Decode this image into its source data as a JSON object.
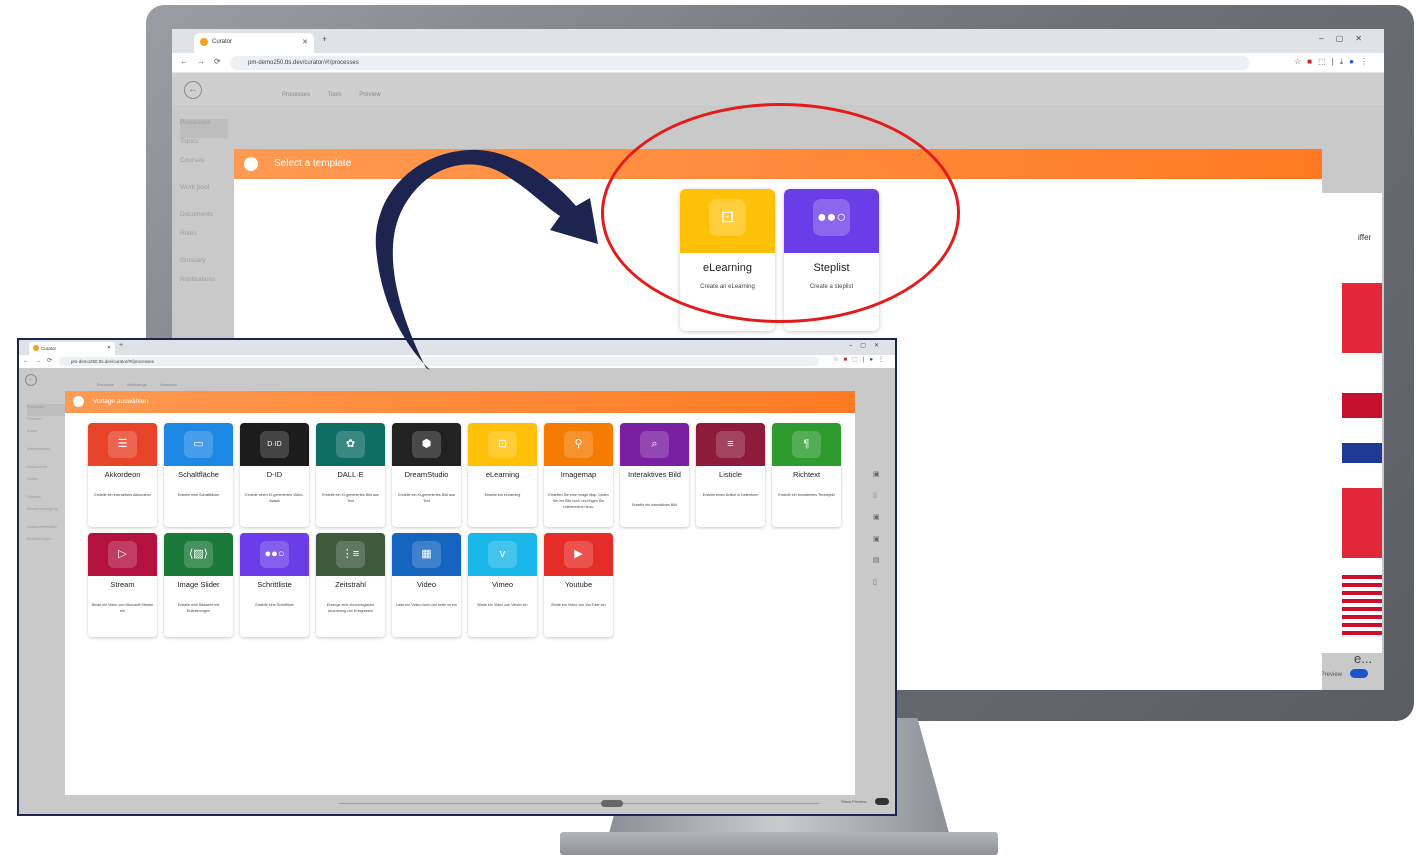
{
  "big_browser": {
    "tab_title": "Curator",
    "url": "pm-demo250.tts.dev/curator/#!/processes",
    "header_tabs": [
      "Processes",
      "Tools",
      "Preview"
    ],
    "nav_items": [
      "Processes",
      "Topics",
      "Courses",
      "Work pool",
      "Documents",
      "Roles",
      "Glossary",
      "Notifications"
    ],
    "right_text_1": "iffer",
    "right_text_2": "e...",
    "show_preview": "Show Preview"
  },
  "big_dialog": {
    "title": "Select a template",
    "templates": [
      {
        "name": "eLearning",
        "desc": "Create an eLearning",
        "icon": "elearning-icon",
        "color": "#ffc107"
      },
      {
        "name": "Steplist",
        "desc": "Create a steplist",
        "icon": "steplist-icon",
        "color": "#6a3de8"
      }
    ]
  },
  "small_browser": {
    "tab_title": "Curator",
    "url": "pm-demo250.tts.dev/curator/#!/processes",
    "header_tabs": [
      "Prozesse",
      "Werkzeuge",
      "Vorschau"
    ],
    "nav_items": [
      "Prozesse",
      "Themen",
      "Kurse",
      "Arbeitsvorrat",
      "Dokumente",
      "Rollen",
      "Glossar",
      "Benachrichtigung",
      "Dokumentenliste",
      "Einstellungen"
    ],
    "show_preview": "Show Preview"
  },
  "small_dialog": {
    "title": "Vorlage auswählen",
    "templates": [
      {
        "name": "Akkordeon",
        "desc": "Erstelle ein interaktives Akkordeon",
        "icon": "accordion-icon",
        "color": "#e8442a"
      },
      {
        "name": "Schaltfläche",
        "desc": "Erstelle eine Schaltfläche",
        "icon": "button-icon",
        "color": "#1e88e5"
      },
      {
        "name": "D-ID",
        "desc": "Erstelle einen KI-generierten Video-Avatar",
        "icon": "did-icon",
        "color": "#1c1c1c"
      },
      {
        "name": "DALL·E",
        "desc": "Erstelle ein KI-generiertes Bild aus Text",
        "icon": "openai-icon",
        "color": "#0e6e66"
      },
      {
        "name": "DreamStudio",
        "desc": "Erstelle ein KI-generiertes Bild aus Text",
        "icon": "dreamstudio-icon",
        "color": "#222222"
      },
      {
        "name": "eLearning",
        "desc": "Erstelle ein eLearning",
        "icon": "elearning-icon",
        "color": "#ffc107"
      },
      {
        "name": "Imagemap",
        "desc": "Erstellen Sie eine Image Map. Laden Sie ein Bild hoch und fügen Sie Linkbereiche hinzu.",
        "icon": "imagemap-icon",
        "color": "#f57c00"
      },
      {
        "name": "Interaktives Bild",
        "desc": "Erstelle ein interaktives Bild",
        "icon": "interactive-image-icon",
        "color": "#7b1fa2"
      },
      {
        "name": "Listicle",
        "desc": "Erstelle einen Artikel in Listenform",
        "icon": "listicle-icon",
        "color": "#8e1b3a"
      },
      {
        "name": "Richtext",
        "desc": "Erstelle ein formatiertes Textobjekt",
        "icon": "pilcrow-icon",
        "color": "#2e9b2e"
      },
      {
        "name": "Stream",
        "desc": "Binde ein Video von Microsoft Stream ein",
        "icon": "stream-icon",
        "color": "#b3123f"
      },
      {
        "name": "Image Slider",
        "desc": "Erstelle eine Bildserie mit Erläuterungen",
        "icon": "image-slider-icon",
        "color": "#1b7a3a"
      },
      {
        "name": "Schrittliste",
        "desc": "Erstelle eine Schrittliste",
        "icon": "steplist-icon",
        "color": "#6a3de8"
      },
      {
        "name": "Zeitstrahl",
        "desc": "Erzeuge eine chronologische Anordnung von Ereignissen",
        "icon": "timeline-icon",
        "color": "#3d5a3d"
      },
      {
        "name": "Video",
        "desc": "Lade ein Video hoch und bette es ein",
        "icon": "video-icon",
        "color": "#1565c0"
      },
      {
        "name": "Vimeo",
        "desc": "Binde ein Video von Vimeo ein",
        "icon": "vimeo-icon",
        "color": "#1ab7ea"
      },
      {
        "name": "Youtube",
        "desc": "Binde ein Video von YouTube ein",
        "icon": "youtube-icon",
        "color": "#e52d27"
      }
    ]
  },
  "annotations": {
    "ellipse_color": "#e31b1b",
    "arrow_color": "#1d2450"
  }
}
